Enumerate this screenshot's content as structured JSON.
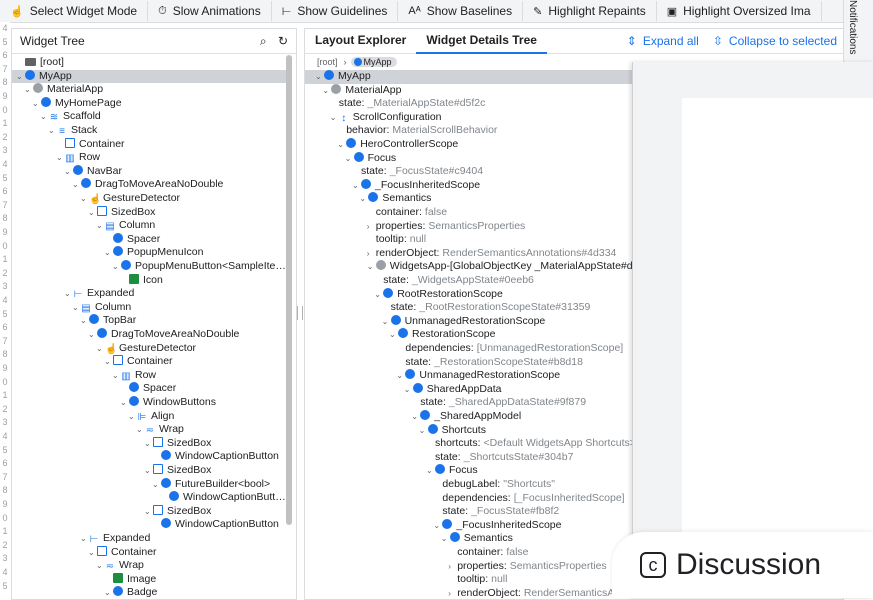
{
  "toolbar": {
    "buttons": [
      {
        "icon": "touch-icon",
        "glyph": "☝",
        "label": "Select Widget Mode"
      },
      {
        "icon": "timer-icon",
        "glyph": "⏱",
        "label": "Slow Animations"
      },
      {
        "icon": "guidelines-icon",
        "glyph": "⊢",
        "label": "Show Guidelines"
      },
      {
        "icon": "baselines-icon",
        "glyph": "Aᴬ",
        "label": "Show Baselines"
      },
      {
        "icon": "repaints-icon",
        "glyph": "✎",
        "label": "Highlight Repaints"
      },
      {
        "icon": "image-icon",
        "glyph": "▣",
        "label": "Highlight Oversized Ima"
      }
    ],
    "side_tab": "Notifications"
  },
  "gutter_numbers": [
    "4",
    "5",
    "6",
    "7",
    "8",
    "9",
    "0",
    "1",
    "2",
    "3",
    "4",
    "5",
    "6",
    "7",
    "8",
    "9",
    "0",
    "1",
    "2",
    "3",
    "4",
    "5",
    "6",
    "7",
    "8",
    "9",
    "0",
    "1",
    "2",
    "3",
    "4",
    "5",
    "6",
    "7",
    "8",
    "9",
    "0",
    "1",
    "2",
    "3",
    "4",
    "5"
  ],
  "widget_tree": {
    "title": "Widget Tree",
    "items": [
      {
        "depth": 0,
        "chev": "",
        "icon": "folder",
        "label": "[root]"
      },
      {
        "depth": 0,
        "chev": "v",
        "icon": "blue",
        "label": "MyApp",
        "selected": true
      },
      {
        "depth": 1,
        "chev": "v",
        "icon": "gray",
        "label": "MaterialApp"
      },
      {
        "depth": 2,
        "chev": "v",
        "icon": "blue",
        "label": "MyHomePage"
      },
      {
        "depth": 3,
        "chev": "v",
        "icon": "glyph",
        "glyph": "≋",
        "label": "Scaffold"
      },
      {
        "depth": 4,
        "chev": "v",
        "icon": "glyph",
        "glyph": "≡",
        "label": "Stack"
      },
      {
        "depth": 5,
        "chev": "",
        "icon": "out",
        "label": "Container"
      },
      {
        "depth": 5,
        "chev": "v",
        "icon": "glyph",
        "glyph": "▥",
        "label": "Row"
      },
      {
        "depth": 6,
        "chev": "v",
        "icon": "blue",
        "label": "NavBar"
      },
      {
        "depth": 7,
        "chev": "v",
        "icon": "blue",
        "label": "DragToMoveAreaNoDouble"
      },
      {
        "depth": 8,
        "chev": "v",
        "icon": "glyph",
        "glyph": "☝",
        "label": "GestureDetector"
      },
      {
        "depth": 9,
        "chev": "v",
        "icon": "out",
        "label": "SizedBox"
      },
      {
        "depth": 10,
        "chev": "v",
        "icon": "glyph",
        "glyph": "▤",
        "label": "Column"
      },
      {
        "depth": 11,
        "chev": "",
        "icon": "blue",
        "label": "Spacer"
      },
      {
        "depth": 11,
        "chev": "v",
        "icon": "blue",
        "label": "PopupMenuIcon"
      },
      {
        "depth": 12,
        "chev": "v",
        "icon": "blue",
        "label": "PopupMenuButton<SampleIte…"
      },
      {
        "depth": 13,
        "chev": "",
        "icon": "sq",
        "label": "Icon"
      },
      {
        "depth": 6,
        "chev": "v",
        "icon": "glyph",
        "glyph": "⊢",
        "label": "Expanded"
      },
      {
        "depth": 7,
        "chev": "v",
        "icon": "glyph",
        "glyph": "▤",
        "label": "Column"
      },
      {
        "depth": 8,
        "chev": "v",
        "icon": "blue",
        "label": "TopBar"
      },
      {
        "depth": 9,
        "chev": "v",
        "icon": "blue",
        "label": "DragToMoveAreaNoDouble"
      },
      {
        "depth": 10,
        "chev": "v",
        "icon": "glyph",
        "glyph": "☝",
        "label": "GestureDetector"
      },
      {
        "depth": 11,
        "chev": "v",
        "icon": "out",
        "label": "Container"
      },
      {
        "depth": 12,
        "chev": "v",
        "icon": "glyph",
        "glyph": "▥",
        "label": "Row"
      },
      {
        "depth": 13,
        "chev": "",
        "icon": "blue",
        "label": "Spacer"
      },
      {
        "depth": 13,
        "chev": "v",
        "icon": "blue",
        "label": "WindowButtons"
      },
      {
        "depth": 14,
        "chev": "v",
        "icon": "glyph",
        "glyph": "⊫",
        "label": "Align"
      },
      {
        "depth": 15,
        "chev": "v",
        "icon": "glyph",
        "glyph": "≂",
        "label": "Wrap"
      },
      {
        "depth": 16,
        "chev": "v",
        "icon": "out",
        "label": "SizedBox"
      },
      {
        "depth": 17,
        "chev": "",
        "icon": "blue",
        "label": "WindowCaptionButton"
      },
      {
        "depth": 16,
        "chev": "v",
        "icon": "out",
        "label": "SizedBox"
      },
      {
        "depth": 17,
        "chev": "v",
        "icon": "blue",
        "label": "FutureBuilder<bool>"
      },
      {
        "depth": 18,
        "chev": "",
        "icon": "blue",
        "label": "WindowCaptionButt…"
      },
      {
        "depth": 16,
        "chev": "v",
        "icon": "out",
        "label": "SizedBox"
      },
      {
        "depth": 17,
        "chev": "",
        "icon": "blue",
        "label": "WindowCaptionButton"
      },
      {
        "depth": 8,
        "chev": "v",
        "icon": "glyph",
        "glyph": "⊢",
        "label": "Expanded"
      },
      {
        "depth": 9,
        "chev": "v",
        "icon": "out",
        "label": "Container"
      },
      {
        "depth": 10,
        "chev": "v",
        "icon": "glyph",
        "glyph": "≂",
        "label": "Wrap"
      },
      {
        "depth": 11,
        "chev": "",
        "icon": "sq",
        "label": "Image"
      },
      {
        "depth": 11,
        "chev": "v",
        "icon": "blue",
        "label": "Badge"
      }
    ]
  },
  "details": {
    "tabs": [
      {
        "label": "Layout Explorer",
        "active": false
      },
      {
        "label": "Widget Details Tree",
        "active": true
      }
    ],
    "expand_all": "Expand all",
    "collapse": "Collapse to selected",
    "breadcrumb": {
      "root": "[root]",
      "current": "MyApp"
    },
    "items": [
      {
        "depth": 0,
        "chev": "v",
        "icon": "blue",
        "label": "MyApp",
        "selected": true
      },
      {
        "depth": 1,
        "chev": "v",
        "icon": "gray",
        "label": "MaterialApp"
      },
      {
        "depth": 2,
        "kind": "prop",
        "key": "state:",
        "val": "_MaterialAppState#d5f2c"
      },
      {
        "depth": 2,
        "chev": "v",
        "icon": "glyph",
        "glyph": "↕",
        "label": "ScrollConfiguration"
      },
      {
        "depth": 3,
        "kind": "prop",
        "key": "behavior:",
        "val": "MaterialScrollBehavior"
      },
      {
        "depth": 3,
        "chev": "v",
        "icon": "blue",
        "label": "HeroControllerScope"
      },
      {
        "depth": 4,
        "chev": "v",
        "icon": "blue",
        "label": "Focus"
      },
      {
        "depth": 5,
        "kind": "prop",
        "key": "state:",
        "val": "_FocusState#c9404"
      },
      {
        "depth": 5,
        "chev": "v",
        "icon": "blue",
        "label": "_FocusInheritedScope"
      },
      {
        "depth": 6,
        "chev": "v",
        "icon": "blue",
        "label": "Semantics"
      },
      {
        "depth": 7,
        "kind": "prop",
        "key": "container:",
        "val": "false"
      },
      {
        "depth": 7,
        "chev": ">",
        "kind": "prop",
        "key": "properties:",
        "val": "SemanticsProperties"
      },
      {
        "depth": 7,
        "kind": "prop",
        "key": "tooltip:",
        "val": "null"
      },
      {
        "depth": 7,
        "chev": ">",
        "kind": "prop",
        "key": "renderObject:",
        "val": "RenderSemanticsAnnotations#4d334"
      },
      {
        "depth": 7,
        "chev": "v",
        "icon": "gray",
        "label": "WidgetsApp-[GlobalObjectKey _MaterialAppState#d5"
      },
      {
        "depth": 8,
        "kind": "prop",
        "key": "state:",
        "val": "_WidgetsAppState#0eeb6"
      },
      {
        "depth": 8,
        "chev": "v",
        "icon": "blue",
        "label": "RootRestorationScope"
      },
      {
        "depth": 9,
        "kind": "prop",
        "key": "state:",
        "val": "_RootRestorationScopeState#31359"
      },
      {
        "depth": 9,
        "chev": "v",
        "icon": "blue",
        "label": "UnmanagedRestorationScope"
      },
      {
        "depth": 10,
        "chev": "v",
        "icon": "blue",
        "label": "RestorationScope"
      },
      {
        "depth": 11,
        "kind": "prop",
        "key": "dependencies:",
        "val": "[UnmanagedRestorationScope]"
      },
      {
        "depth": 11,
        "kind": "prop",
        "key": "state:",
        "val": "_RestorationScopeState#b8d18"
      },
      {
        "depth": 11,
        "chev": "v",
        "icon": "blue",
        "label": "UnmanagedRestorationScope"
      },
      {
        "depth": 12,
        "chev": "v",
        "icon": "blue",
        "label": "SharedAppData"
      },
      {
        "depth": 13,
        "kind": "prop",
        "key": "state:",
        "val": "_SharedAppDataState#9f879"
      },
      {
        "depth": 13,
        "chev": "v",
        "icon": "blue",
        "label": "_SharedAppModel"
      },
      {
        "depth": 14,
        "chev": "v",
        "icon": "blue",
        "label": "Shortcuts"
      },
      {
        "depth": 15,
        "kind": "prop",
        "key": "shortcuts:",
        "val": "<Default WidgetsApp Shortcuts>"
      },
      {
        "depth": 15,
        "kind": "prop",
        "key": "state:",
        "val": "_ShortcutsState#304b7"
      },
      {
        "depth": 15,
        "chev": "v",
        "icon": "blue",
        "label": "Focus"
      },
      {
        "depth": 16,
        "kind": "prop",
        "key": "debugLabel:",
        "val": "\"Shortcuts\""
      },
      {
        "depth": 16,
        "kind": "prop",
        "key": "dependencies:",
        "val": "[_FocusInheritedScope]"
      },
      {
        "depth": 16,
        "kind": "prop",
        "key": "state:",
        "val": "_FocusState#fb8f2"
      },
      {
        "depth": 16,
        "chev": "v",
        "icon": "blue",
        "label": "_FocusInheritedScope"
      },
      {
        "depth": 17,
        "chev": "v",
        "icon": "blue",
        "label": "Semantics"
      },
      {
        "depth": 18,
        "kind": "prop",
        "key": "container:",
        "val": "false"
      },
      {
        "depth": 18,
        "chev": ">",
        "kind": "prop",
        "key": "properties:",
        "val": "SemanticsProperties"
      },
      {
        "depth": 18,
        "kind": "prop",
        "key": "tooltip:",
        "val": "null"
      },
      {
        "depth": 18,
        "chev": ">",
        "kind": "prop",
        "key": "renderObject:",
        "val": "RenderSemanticsA"
      }
    ]
  },
  "discussion": {
    "icon": "discussion-icon",
    "label": "Discussion"
  },
  "colors": {
    "accent": "#1a73e8",
    "widget_icon": "#1a73e8",
    "image_icon": "#1e8e3e",
    "selected_row": "#cfd3d8"
  }
}
